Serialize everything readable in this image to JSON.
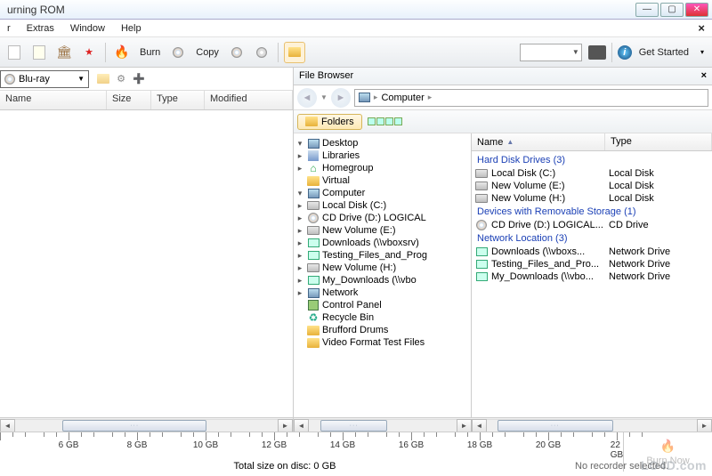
{
  "window": {
    "title": "urning ROM"
  },
  "menu": {
    "items": [
      "r",
      "Extras",
      "Window",
      "Help"
    ]
  },
  "toolbar": {
    "burn": "Burn",
    "copy": "Copy",
    "getStarted": "Get Started"
  },
  "leftPanel": {
    "discType": "Blu-ray",
    "columns": {
      "name": "Name",
      "size": "Size",
      "type": "Type",
      "modified": "Modified"
    }
  },
  "fileBrowser": {
    "title": "File Browser",
    "foldersBtn": "Folders",
    "breadcrumb": {
      "root": "Computer"
    },
    "tree": [
      {
        "label": "Desktop",
        "indent": 0,
        "exp": "▾",
        "icon": "comp"
      },
      {
        "label": "Libraries",
        "indent": 1,
        "exp": "▸",
        "icon": "lib"
      },
      {
        "label": "Homegroup",
        "indent": 1,
        "exp": "▸",
        "icon": "home"
      },
      {
        "label": "Virtual",
        "indent": 1,
        "exp": "",
        "icon": "folder"
      },
      {
        "label": "Computer",
        "indent": 1,
        "exp": "▾",
        "icon": "comp"
      },
      {
        "label": "Local Disk (C:)",
        "indent": 2,
        "exp": "▸",
        "icon": "drive"
      },
      {
        "label": "CD Drive (D:) LOGICAL",
        "indent": 2,
        "exp": "▸",
        "icon": "cd"
      },
      {
        "label": "New Volume (E:)",
        "indent": 2,
        "exp": "▸",
        "icon": "drive"
      },
      {
        "label": "Downloads (\\\\vboxsrv)",
        "indent": 2,
        "exp": "▸",
        "icon": "net"
      },
      {
        "label": "Testing_Files_and_Prog",
        "indent": 2,
        "exp": "▸",
        "icon": "net"
      },
      {
        "label": "New Volume (H:)",
        "indent": 2,
        "exp": "▸",
        "icon": "drive"
      },
      {
        "label": "My_Downloads (\\\\vbo",
        "indent": 2,
        "exp": "▸",
        "icon": "net"
      },
      {
        "label": "Network",
        "indent": 1,
        "exp": "▸",
        "icon": "comp"
      },
      {
        "label": "Control Panel",
        "indent": 1,
        "exp": "",
        "icon": "panel"
      },
      {
        "label": "Recycle Bin",
        "indent": 1,
        "exp": "",
        "icon": "recycle"
      },
      {
        "label": "Brufford Drums",
        "indent": 1,
        "exp": "",
        "icon": "folder"
      },
      {
        "label": "Video Format Test Files",
        "indent": 1,
        "exp": "",
        "icon": "folder"
      }
    ],
    "detail": {
      "columns": {
        "name": "Name",
        "type": "Type"
      },
      "groups": [
        {
          "title": "Hard Disk Drives (3)",
          "rows": [
            {
              "name": "Local Disk (C:)",
              "type": "Local Disk",
              "icon": "drive"
            },
            {
              "name": "New Volume (E:)",
              "type": "Local Disk",
              "icon": "drive"
            },
            {
              "name": "New Volume (H:)",
              "type": "Local Disk",
              "icon": "drive"
            }
          ]
        },
        {
          "title": "Devices with Removable Storage (1)",
          "rows": [
            {
              "name": "CD Drive (D:) LOGICAL...",
              "type": "CD Drive",
              "icon": "cd"
            }
          ]
        },
        {
          "title": "Network Location (3)",
          "rows": [
            {
              "name": "Downloads (\\\\vboxs...",
              "type": "Network Drive",
              "icon": "net"
            },
            {
              "name": "Testing_Files_and_Pro...",
              "type": "Network Drive",
              "icon": "net"
            },
            {
              "name": "My_Downloads (\\\\vbo...",
              "type": "Network Drive",
              "icon": "net"
            }
          ]
        }
      ]
    }
  },
  "ruler": {
    "labels": [
      "",
      "6 GB",
      "8 GB",
      "10 GB",
      "12 GB",
      "14 GB",
      "16 GB",
      "18 GB",
      "20 GB",
      "22 GB"
    ],
    "positions": [
      0,
      11,
      22,
      33,
      44,
      55,
      66,
      77,
      88,
      99
    ]
  },
  "status": {
    "total": "Total size on disc: 0 GB",
    "recorder": "No recorder selected.",
    "burnNow": "Burn Now"
  },
  "watermark": "LO4D.com"
}
